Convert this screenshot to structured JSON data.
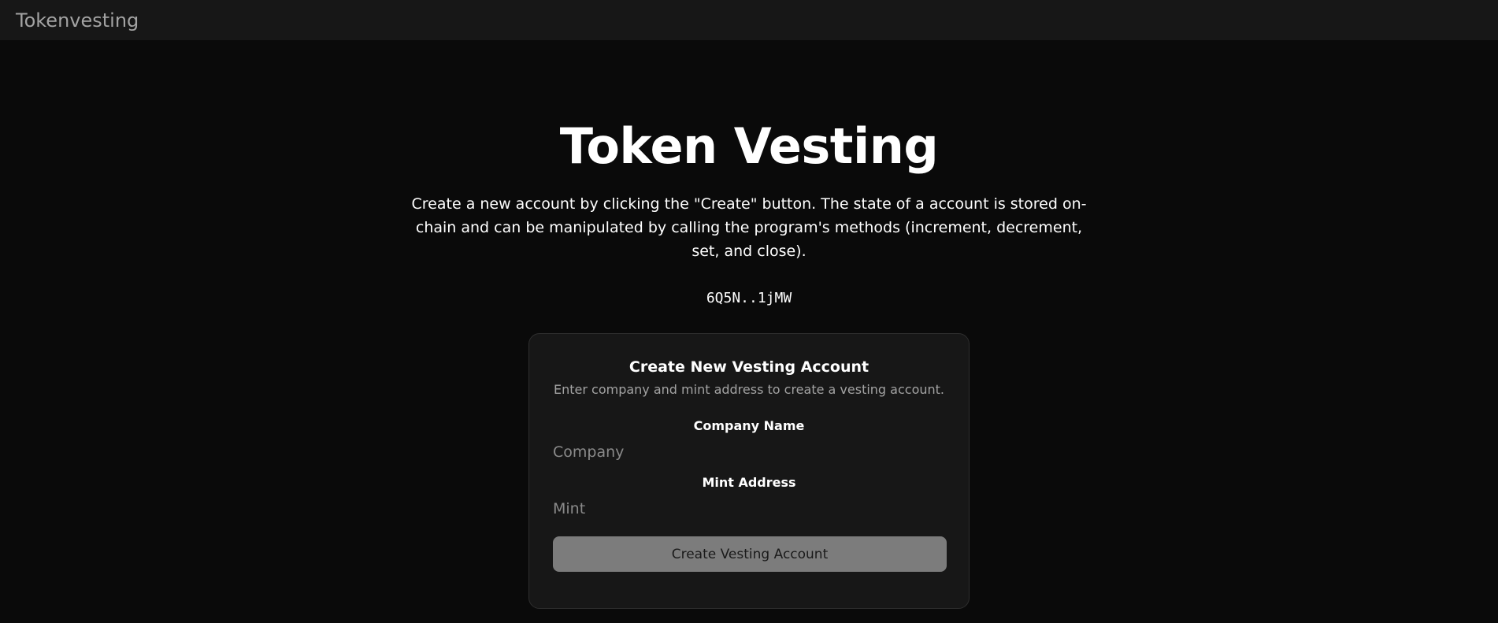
{
  "header": {
    "brand": "Tokenvesting"
  },
  "hero": {
    "title": "Token Vesting",
    "description": "Create a new account by clicking the \"Create\" button. The state of a account is stored on-chain and can be manipulated by calling the program's methods (increment, decrement, set, and close).",
    "program_address": "6Q5N..1jMW"
  },
  "form": {
    "title": "Create New Vesting Account",
    "subtitle": "Enter company and mint address to create a vesting account.",
    "company_label": "Company Name",
    "company_placeholder": "Company",
    "company_value": "",
    "mint_label": "Mint Address",
    "mint_placeholder": "Mint",
    "mint_value": "",
    "submit_label": "Create Vesting Account"
  },
  "colors": {
    "background": "#0a0a0a",
    "header_bg": "#171717",
    "card_bg": "#171717",
    "button_bg": "#7c7c7c",
    "muted_text": "#a3a3a3"
  }
}
